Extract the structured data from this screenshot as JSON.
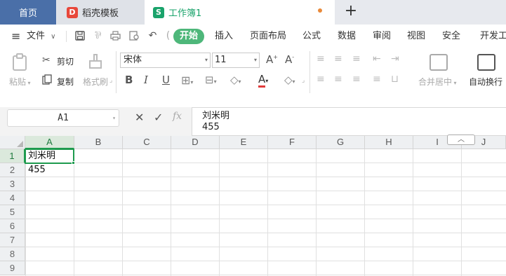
{
  "tabs": {
    "home": "首页",
    "template": "稻壳模板",
    "workbook": "工作簿1",
    "template_logo": "D",
    "workbook_logo": "S"
  },
  "menu": {
    "file": "文件",
    "start": "开始",
    "items": [
      "插入",
      "页面布局",
      "公式",
      "数据",
      "审阅",
      "视图",
      "安全",
      "开发工"
    ]
  },
  "ribbon": {
    "paste": "粘贴",
    "cut": "剪切",
    "copy": "复制",
    "format_painter": "格式刷",
    "font_name": "宋体",
    "font_size": "11",
    "merge_center": "合并居中",
    "wrap_text": "自动换行"
  },
  "formula_bar": {
    "name_box": "A1",
    "fx": "fx",
    "content_line1": "刘米明",
    "content_line2": "455"
  },
  "grid": {
    "columns": [
      "A",
      "B",
      "C",
      "D",
      "E",
      "F",
      "G",
      "H",
      "I",
      "J"
    ],
    "rows": [
      "1",
      "2",
      "3",
      "4",
      "5",
      "6",
      "7",
      "8",
      "9"
    ],
    "cells": {
      "A1": "刘米明",
      "A2": "455"
    },
    "active_cell": "A1"
  },
  "colors": {
    "accent_green": "#1e9b4e",
    "start_button": "#4eb77a",
    "home_tab": "#4a6fa8",
    "modified_dot": "#e98a3a"
  }
}
